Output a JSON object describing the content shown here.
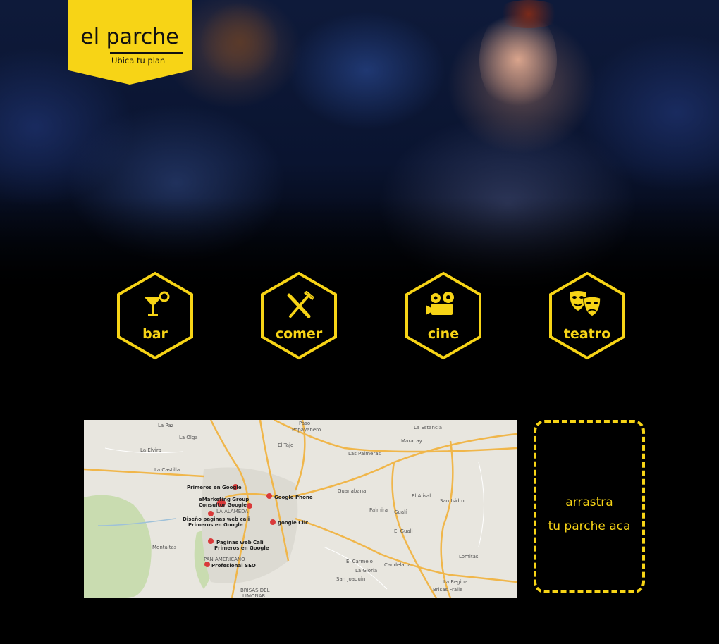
{
  "brand": {
    "name": "el parche",
    "tagline": "Ubica tu plan",
    "color": "#f7d416"
  },
  "hero": {
    "icon": "crowd-photo"
  },
  "categories": [
    {
      "label": "bar",
      "icon": "cocktail-icon"
    },
    {
      "label": "comer",
      "icon": "fork-knife-icon"
    },
    {
      "label": "cine",
      "icon": "movie-camera-icon"
    },
    {
      "label": "teatro",
      "icon": "theater-masks-icon"
    }
  ],
  "map": {
    "places": [
      "Paso",
      "Popayanero",
      "La Estancia",
      "La Paz",
      "La Olga",
      "El Tajo",
      "Maracay",
      "Las Palmeras",
      "La Elvira",
      "La Castilla",
      "Guanabanal",
      "Palmira",
      "Gualí",
      "El Alisal",
      "San Isidro",
      "El Guali",
      "Montaitas",
      "Lomitas",
      "El Carmelo",
      "Candelaria",
      "La Gloria",
      "San Joaquin",
      "La Regina",
      "Brisas Fraile",
      "BRISAS DEL",
      "LIMONAR",
      "PAN AMERICANO",
      "LA ALAMEDA"
    ],
    "markers": [
      "Primeros en Google",
      "Google Phone",
      "eMarketing Group",
      "Consultor Google",
      "Diseño paginas web cali",
      "Primeros en Google",
      "google Clic",
      "Paginas web Cali",
      "Primeros en Google",
      "Profesional SEO"
    ]
  },
  "dropzone": {
    "line1": "arrastra",
    "line2": "tu parche aca"
  }
}
